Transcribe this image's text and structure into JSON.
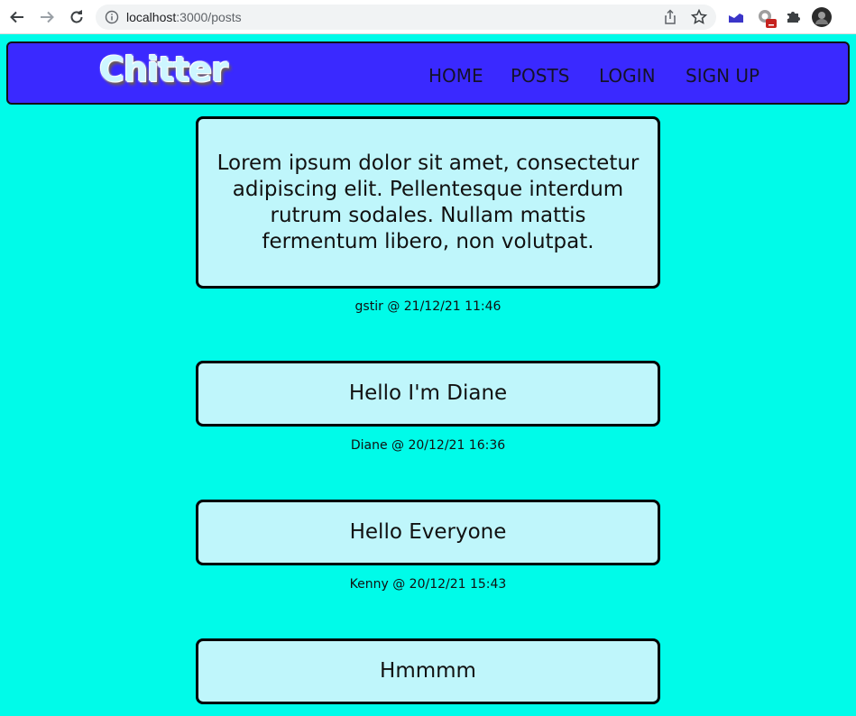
{
  "browser": {
    "url_host": "localhost",
    "url_rest": ":3000/posts"
  },
  "header": {
    "logo": "Chitter",
    "nav": [
      "HOME",
      "POSTS",
      "LOGIN",
      "SIGN UP"
    ]
  },
  "posts": [
    {
      "text": "Lorem ipsum dolor sit amet, consectetur adipiscing elit. Pellentesque interdum rutrum sodales. Nullam mattis fermentum libero, non volutpat.",
      "meta": "gstir @ 21/12/21 11:46"
    },
    {
      "text": "Hello I'm Diane",
      "meta": "Diane @ 20/12/21 16:36"
    },
    {
      "text": "Hello Everyone",
      "meta": "Kenny @ 20/12/21 15:43"
    },
    {
      "text": "Hmmmm",
      "meta": ""
    }
  ],
  "colors": {
    "page_bg": "#00fbe9",
    "header_bg": "#3a29ff",
    "post_bg": "#bff6fb"
  },
  "icons": [
    "back-arrow-icon",
    "forward-arrow-icon",
    "reload-icon",
    "info-icon",
    "share-icon",
    "star-icon",
    "extension-icon",
    "puzzle-icon",
    "profile-avatar"
  ]
}
